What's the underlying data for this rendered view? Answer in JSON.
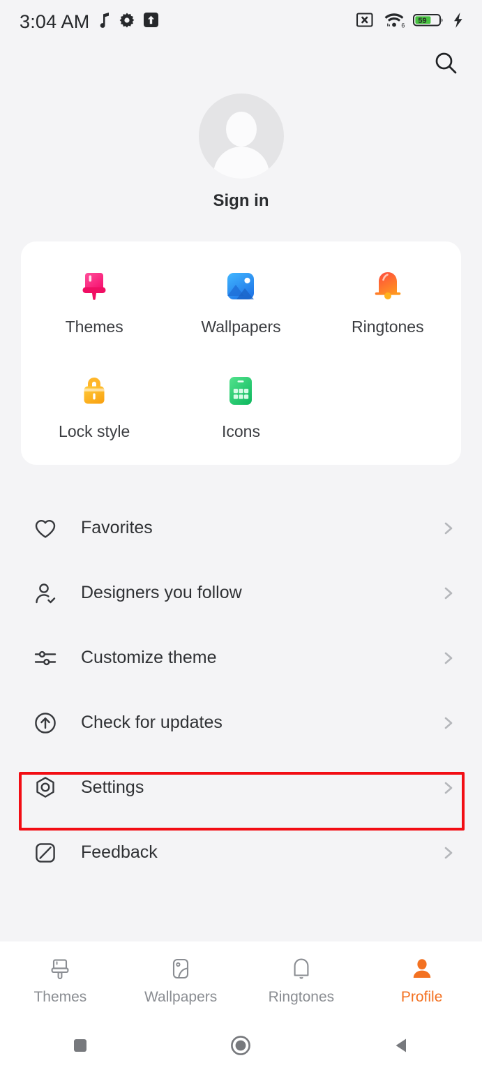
{
  "status_bar": {
    "clock": "3:04 AM",
    "left_icons": [
      "music-note-icon",
      "gear-icon",
      "upload-box-icon"
    ],
    "right_icons": [
      "sim-off-icon",
      "wifi-6-icon",
      "battery-icon",
      "charging-bolt-icon"
    ],
    "battery_percent": "59",
    "wifi_generation": "6",
    "battery_fill_color": "#46c23f"
  },
  "header": {
    "search_icon": "search-icon"
  },
  "profile": {
    "avatar_icon": "default-avatar-icon",
    "sign_in_label": "Sign in"
  },
  "shortcuts": [
    {
      "label": "Themes",
      "icon": "paint-brush-icon",
      "color": "#f6257d"
    },
    {
      "label": "Wallpapers",
      "icon": "image-icon",
      "color": "#2f9df4"
    },
    {
      "label": "Ringtones",
      "icon": "bell-icon",
      "color": "#fb5c2c"
    },
    {
      "label": "Lock style",
      "icon": "padlock-icon",
      "color": "#fbb515"
    },
    {
      "label": "Icons",
      "icon": "app-grid-icon",
      "color": "#2ecc71"
    }
  ],
  "menu": [
    {
      "label": "Favorites",
      "icon": "heart-icon",
      "chevron": "chevron-right-icon",
      "highlighted": false
    },
    {
      "label": "Designers you follow",
      "icon": "person-check-icon",
      "chevron": "chevron-right-icon",
      "highlighted": false
    },
    {
      "label": "Customize theme",
      "icon": "sliders-icon",
      "chevron": "chevron-right-icon",
      "highlighted": false
    },
    {
      "label": "Check for updates",
      "icon": "arrow-up-circle-icon",
      "chevron": "chevron-right-icon",
      "highlighted": false
    },
    {
      "label": "Settings",
      "icon": "nut-gear-icon",
      "chevron": "chevron-right-icon",
      "highlighted": true
    },
    {
      "label": "Feedback",
      "icon": "edit-square-icon",
      "chevron": "chevron-right-icon",
      "highlighted": false
    }
  ],
  "highlight": {
    "color": "#f20d14",
    "target": "Settings"
  },
  "tabs": [
    {
      "label": "Themes",
      "icon": "brush-outline-icon",
      "active": false
    },
    {
      "label": "Wallpapers",
      "icon": "image-outline-icon",
      "active": false
    },
    {
      "label": "Ringtones",
      "icon": "bell-outline-icon",
      "active": false
    },
    {
      "label": "Profile",
      "icon": "person-filled-icon",
      "active": true
    }
  ],
  "active_tab_color": "#f37121",
  "system_nav": [
    {
      "name": "recents-button",
      "icon": "square-icon"
    },
    {
      "name": "home-button",
      "icon": "circle-icon"
    },
    {
      "name": "back-button",
      "icon": "triangle-left-icon"
    }
  ]
}
